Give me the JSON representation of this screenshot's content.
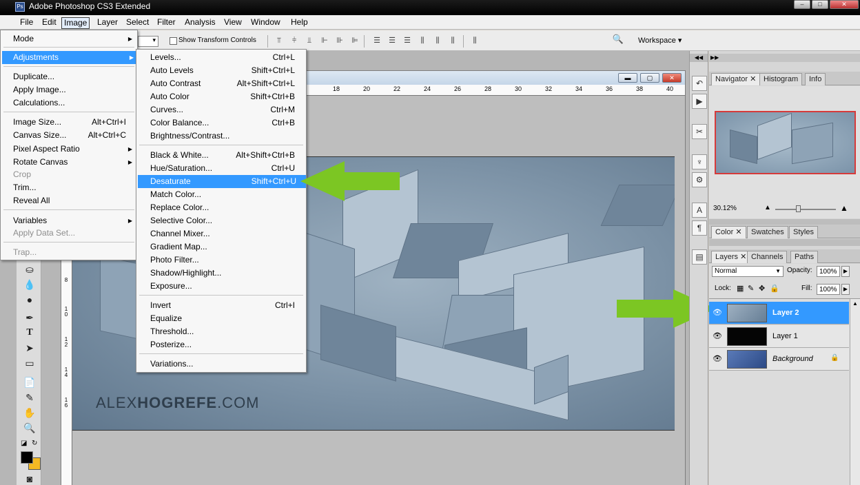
{
  "app": {
    "title": "Adobe Photoshop CS3 Extended",
    "icon_text": "Ps"
  },
  "window_controls": {
    "minimize": "–",
    "maximize": "□",
    "close": "✕"
  },
  "menubar": {
    "items": [
      "File",
      "Edit",
      "Image",
      "Layer",
      "Select",
      "Filter",
      "Analysis",
      "View",
      "Window",
      "Help"
    ],
    "active": "Image"
  },
  "options_bar": {
    "show_transform_controls": "Show Transform Controls",
    "checked": false,
    "workspace": "Workspace ▾"
  },
  "image_menu": {
    "items": [
      {
        "label": "Mode",
        "submenu": true
      },
      {
        "label": "Adjustments",
        "submenu": true,
        "highlighted": true
      },
      {
        "label": "Duplicate..."
      },
      {
        "label": "Apply Image..."
      },
      {
        "label": "Calculations..."
      },
      {
        "label": "Image Size...",
        "shortcut": "Alt+Ctrl+I"
      },
      {
        "label": "Canvas Size...",
        "shortcut": "Alt+Ctrl+C"
      },
      {
        "label": "Pixel Aspect Ratio",
        "submenu": true
      },
      {
        "label": "Rotate Canvas",
        "submenu": true
      },
      {
        "label": "Crop",
        "disabled": true
      },
      {
        "label": "Trim..."
      },
      {
        "label": "Reveal All"
      },
      {
        "label": "Variables",
        "submenu": true
      },
      {
        "label": "Apply Data Set...",
        "disabled": true
      },
      {
        "label": "Trap...",
        "disabled": true
      }
    ]
  },
  "adjustments_menu": {
    "items": [
      {
        "label": "Levels...",
        "shortcut": "Ctrl+L"
      },
      {
        "label": "Auto Levels",
        "shortcut": "Shift+Ctrl+L"
      },
      {
        "label": "Auto Contrast",
        "shortcut": "Alt+Shift+Ctrl+L"
      },
      {
        "label": "Auto Color",
        "shortcut": "Shift+Ctrl+B"
      },
      {
        "label": "Curves...",
        "shortcut": "Ctrl+M"
      },
      {
        "label": "Color Balance...",
        "shortcut": "Ctrl+B"
      },
      {
        "label": "Brightness/Contrast...",
        "shortcut": ""
      },
      {
        "label": "Black & White...",
        "shortcut": "Alt+Shift+Ctrl+B"
      },
      {
        "label": "Hue/Saturation...",
        "shortcut": "Ctrl+U"
      },
      {
        "label": "Desaturate",
        "shortcut": "Shift+Ctrl+U",
        "highlighted": true
      },
      {
        "label": "Match Color...",
        "shortcut": ""
      },
      {
        "label": "Replace Color...",
        "shortcut": ""
      },
      {
        "label": "Selective Color...",
        "shortcut": ""
      },
      {
        "label": "Channel Mixer...",
        "shortcut": ""
      },
      {
        "label": "Gradient Map...",
        "shortcut": ""
      },
      {
        "label": "Photo Filter...",
        "shortcut": ""
      },
      {
        "label": "Shadow/Highlight...",
        "shortcut": ""
      },
      {
        "label": "Exposure...",
        "shortcut": ""
      },
      {
        "label": "Invert",
        "shortcut": "Ctrl+I"
      },
      {
        "label": "Equalize",
        "shortcut": ""
      },
      {
        "label": "Threshold...",
        "shortcut": ""
      },
      {
        "label": "Posterize...",
        "shortcut": ""
      },
      {
        "label": "Variations...",
        "shortcut": ""
      }
    ]
  },
  "document": {
    "ruler_labels": [
      "18",
      "20",
      "22",
      "24",
      "26",
      "28",
      "30",
      "32",
      "34",
      "36",
      "38",
      "40"
    ],
    "vruler_labels": [
      "8",
      "10",
      "12",
      "14",
      "16"
    ],
    "watermark_light": "ALEX",
    "watermark_bold": "HOGREFE",
    "watermark_tail": ".COM"
  },
  "navigator_panel": {
    "tabs": [
      "Navigator",
      "Histogram",
      "Info"
    ],
    "zoom": "30.12%"
  },
  "color_panel": {
    "tabs": [
      "Color",
      "Swatches",
      "Styles"
    ]
  },
  "layers_panel": {
    "tabs": [
      "Layers",
      "Channels",
      "Paths"
    ],
    "blend_mode": "Normal",
    "opacity_label": "Opacity:",
    "opacity": "100%",
    "lock_label": "Lock:",
    "fill_label": "Fill:",
    "fill": "100%",
    "layers": [
      {
        "name": "Layer 2",
        "selected": true
      },
      {
        "name": "Layer 1",
        "selected": false
      },
      {
        "name": "Background",
        "selected": false,
        "locked": true
      }
    ]
  },
  "colors": {
    "highlight": "#3399ff",
    "arrow": "#7cc623"
  }
}
